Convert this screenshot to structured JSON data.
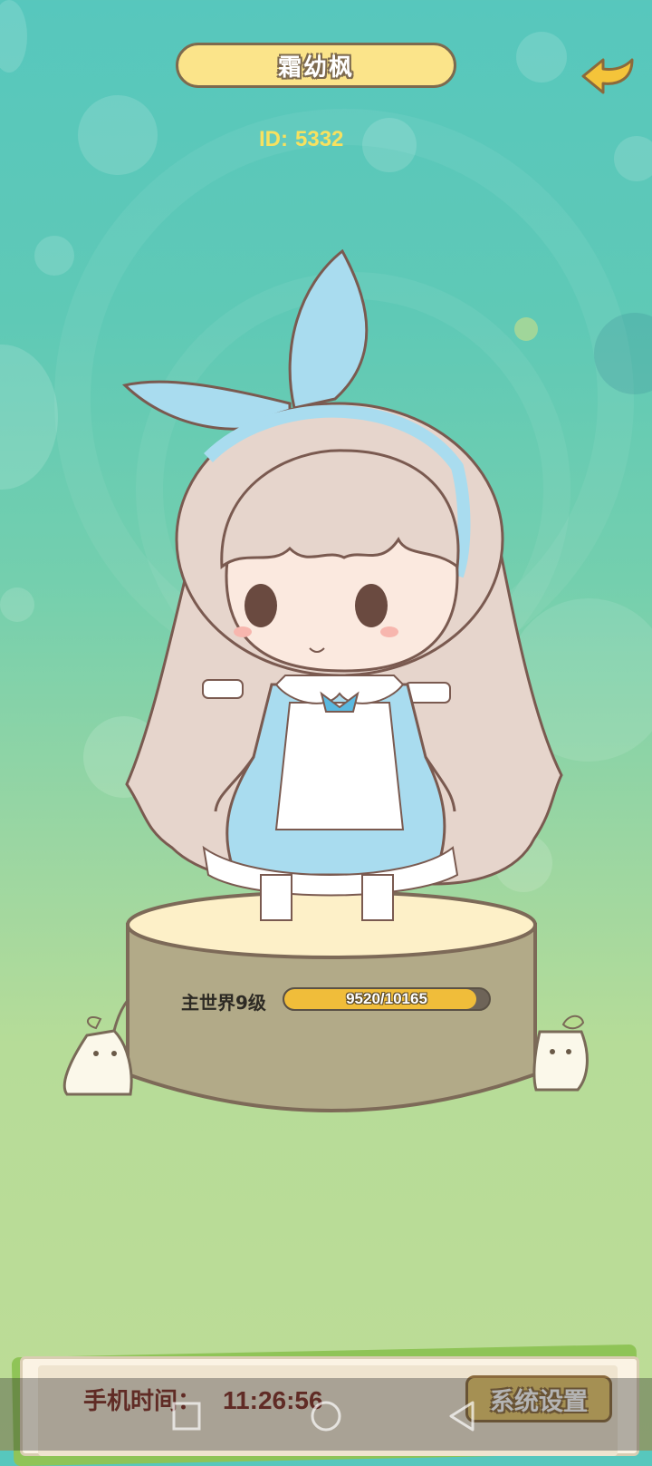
{
  "profile": {
    "name": "霜幼枫",
    "id_label": "ID:",
    "id_value": "5332"
  },
  "level": {
    "label": "主世界9级",
    "exp_current": 9520,
    "exp_max": 10165,
    "exp_text": "9520/10165",
    "exp_fraction": 0.937
  },
  "bottom_panel": {
    "time_label": "手机时间：",
    "time_value": "11:26:56",
    "settings_label": "系统设置"
  },
  "icons": {
    "back": "back-arrow-icon",
    "nav_recent": "square-recents-icon",
    "nav_home": "circle-home-icon",
    "nav_back": "triangle-back-icon"
  },
  "colors": {
    "name_plate": "#fbe48a",
    "exp_fill": "#f0bd3a",
    "id_text": "#f7e15f",
    "time_text": "#7e2d24",
    "settings_button": "#e9c86a"
  }
}
